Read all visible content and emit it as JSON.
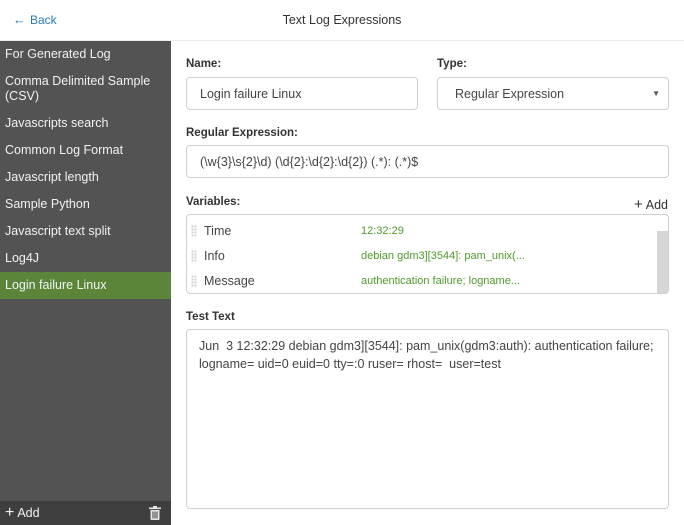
{
  "header": {
    "back_label": "Back",
    "title": "Text Log Expressions"
  },
  "sidebar": {
    "items": [
      {
        "label": "For Generated Log"
      },
      {
        "label": "Comma Delimited Sample (CSV)"
      },
      {
        "label": "Javascripts search"
      },
      {
        "label": "Common Log Format"
      },
      {
        "label": "Javascript length"
      },
      {
        "label": "Sample Python"
      },
      {
        "label": "Javascript text split"
      },
      {
        "label": "Log4J"
      },
      {
        "label": "Login failure Linux",
        "active": true
      }
    ],
    "add_label": "Add"
  },
  "form": {
    "name_label": "Name:",
    "name_value": "Login failure Linux",
    "type_label": "Type:",
    "type_value": "Regular Expression",
    "regex_label": "Regular Expression:",
    "regex_value": "(\\w{3}\\s{2}\\d) (\\d{2}:\\d{2}:\\d{2}) (.*): (.*)$",
    "variables_label": "Variables:",
    "variables_add_label": "Add",
    "variables": [
      {
        "name": "Time",
        "value": "12:32:29"
      },
      {
        "name": "Info",
        "value": "debian gdm3][3544]: pam_unix(..."
      },
      {
        "name": "Message",
        "value": "authentication failure; logname..."
      }
    ],
    "test_text_label": "Test Text",
    "test_text_value": "Jun  3 12:32:29 debian gdm3][3544]: pam_unix(gdm3:auth): authentication failure;\nlogname= uid=0 euid=0 tty=:0 ruser= rhost=  user=test"
  },
  "colors": {
    "accent_active": "#5b863a",
    "sidebar_bg": "#535353",
    "link_blue": "#2a7ab8",
    "var_value_green": "#4e9a2c"
  }
}
